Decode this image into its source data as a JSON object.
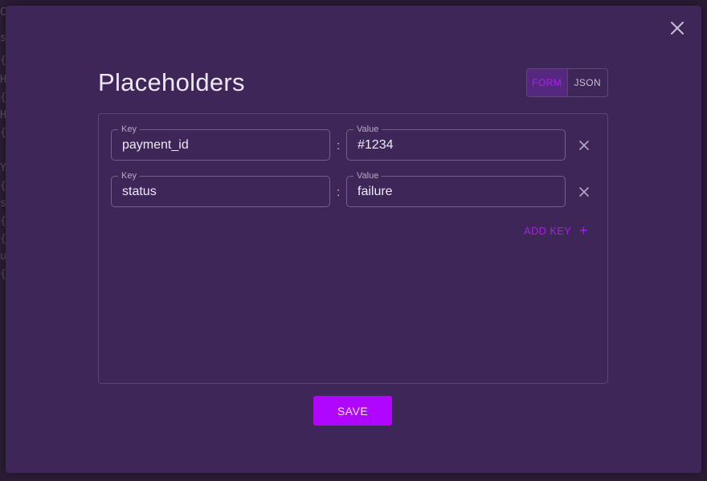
{
  "dialog": {
    "title": "Placeholders",
    "close_icon": "close-icon"
  },
  "view_toggle": {
    "options": [
      {
        "label": "FORM",
        "active": true
      },
      {
        "label": "JSON",
        "active": false
      }
    ]
  },
  "fields": {
    "key_label": "Key",
    "value_label": "Value",
    "separator": ":",
    "rows": [
      {
        "key": "payment_id",
        "value": "#1234"
      },
      {
        "key": "status",
        "value": "failure"
      }
    ]
  },
  "add_key": {
    "label": "ADD KEY",
    "icon": "+"
  },
  "footer": {
    "save_label": "SAVE"
  },
  "background": {
    "glyphs": [
      "C",
      "s",
      "{",
      "H",
      "{",
      "H",
      "{",
      "Y",
      "{",
      "s",
      "{",
      "{",
      "u",
      "{"
    ]
  },
  "colors": {
    "accent": "#b006ff",
    "modal_bg": "#3e2659",
    "active_toggle_text": "#b21cf7"
  }
}
